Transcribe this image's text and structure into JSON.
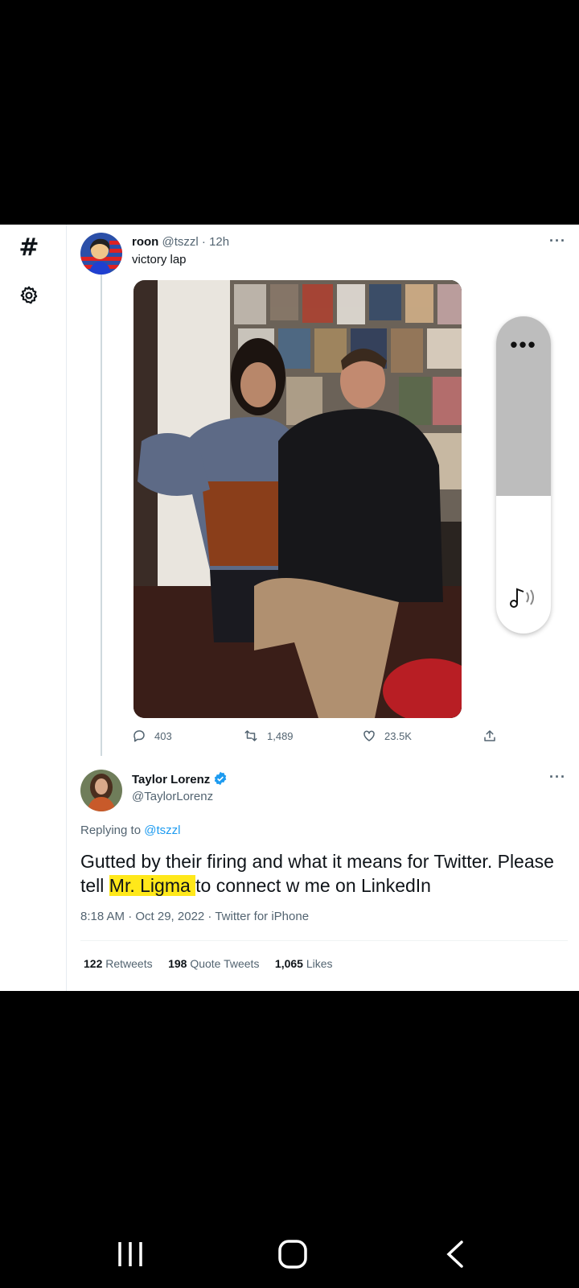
{
  "sidebar": {
    "hashtag_icon": "#",
    "settings_icon": "gear-icon"
  },
  "tweet1": {
    "name": "roon",
    "handle": "@tszzl",
    "time": "12h",
    "text": "victory lap",
    "more": "···",
    "actions": {
      "replies": "403",
      "retweets": "1,489",
      "likes": "23.5K"
    }
  },
  "tweet2": {
    "name": "Taylor Lorenz",
    "handle": "@TaylorLorenz",
    "more": "···",
    "replying_prefix": "Replying to",
    "replying_handle": "@tszzl",
    "text_before": "Gutted by their firing and what it means for Twitter. Please tell ",
    "text_highlight": "Mr. Ligma ",
    "text_after": "to connect w me on LinkedIn",
    "meta": "8:18 AM · Oct 29, 2022 · Twitter for iPhone",
    "stats": {
      "retweets_count": "122",
      "retweets_label": "Retweets",
      "quotes_count": "198",
      "quotes_label": "Quote Tweets",
      "likes_count": "1,065",
      "likes_label": "Likes"
    }
  },
  "volume_panel": {
    "dots": "•••",
    "level": 0.43,
    "icon": "music-note-volume-icon"
  },
  "navbar": {
    "recents": "recents-icon",
    "home": "home-icon",
    "back": "back-icon"
  },
  "colors": {
    "accent": "#1d9bf0",
    "highlight": "#ffe81a",
    "muted": "#536471"
  }
}
